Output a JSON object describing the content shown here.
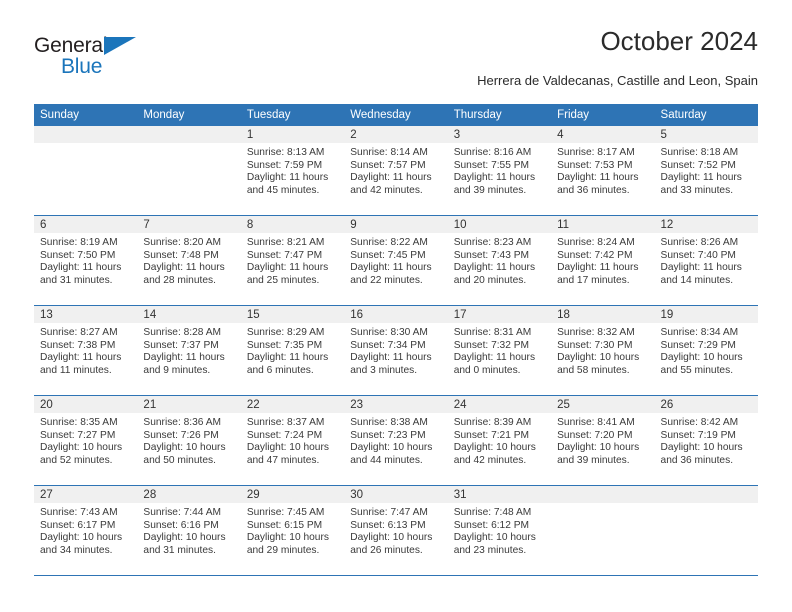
{
  "brand": {
    "name_top": "General",
    "name_bottom": "Blue",
    "triangle_color": "#1b75bb"
  },
  "header": {
    "title": "October 2024",
    "subtitle": "Herrera de Valdecanas, Castille and Leon, Spain"
  },
  "theme": {
    "header_blue": "#2e74b5",
    "daynum_band": "#f0f0f0",
    "text": "#3a3a3a"
  },
  "weekday_headers": [
    "Sunday",
    "Monday",
    "Tuesday",
    "Wednesday",
    "Thursday",
    "Friday",
    "Saturday"
  ],
  "weeks": [
    [
      {
        "day": "",
        "sunrise": "",
        "sunset": "",
        "daylight1": "",
        "daylight2": ""
      },
      {
        "day": "",
        "sunrise": "",
        "sunset": "",
        "daylight1": "",
        "daylight2": ""
      },
      {
        "day": "1",
        "sunrise": "Sunrise: 8:13 AM",
        "sunset": "Sunset: 7:59 PM",
        "daylight1": "Daylight: 11 hours",
        "daylight2": "and 45 minutes."
      },
      {
        "day": "2",
        "sunrise": "Sunrise: 8:14 AM",
        "sunset": "Sunset: 7:57 PM",
        "daylight1": "Daylight: 11 hours",
        "daylight2": "and 42 minutes."
      },
      {
        "day": "3",
        "sunrise": "Sunrise: 8:16 AM",
        "sunset": "Sunset: 7:55 PM",
        "daylight1": "Daylight: 11 hours",
        "daylight2": "and 39 minutes."
      },
      {
        "day": "4",
        "sunrise": "Sunrise: 8:17 AM",
        "sunset": "Sunset: 7:53 PM",
        "daylight1": "Daylight: 11 hours",
        "daylight2": "and 36 minutes."
      },
      {
        "day": "5",
        "sunrise": "Sunrise: 8:18 AM",
        "sunset": "Sunset: 7:52 PM",
        "daylight1": "Daylight: 11 hours",
        "daylight2": "and 33 minutes."
      }
    ],
    [
      {
        "day": "6",
        "sunrise": "Sunrise: 8:19 AM",
        "sunset": "Sunset: 7:50 PM",
        "daylight1": "Daylight: 11 hours",
        "daylight2": "and 31 minutes."
      },
      {
        "day": "7",
        "sunrise": "Sunrise: 8:20 AM",
        "sunset": "Sunset: 7:48 PM",
        "daylight1": "Daylight: 11 hours",
        "daylight2": "and 28 minutes."
      },
      {
        "day": "8",
        "sunrise": "Sunrise: 8:21 AM",
        "sunset": "Sunset: 7:47 PM",
        "daylight1": "Daylight: 11 hours",
        "daylight2": "and 25 minutes."
      },
      {
        "day": "9",
        "sunrise": "Sunrise: 8:22 AM",
        "sunset": "Sunset: 7:45 PM",
        "daylight1": "Daylight: 11 hours",
        "daylight2": "and 22 minutes."
      },
      {
        "day": "10",
        "sunrise": "Sunrise: 8:23 AM",
        "sunset": "Sunset: 7:43 PM",
        "daylight1": "Daylight: 11 hours",
        "daylight2": "and 20 minutes."
      },
      {
        "day": "11",
        "sunrise": "Sunrise: 8:24 AM",
        "sunset": "Sunset: 7:42 PM",
        "daylight1": "Daylight: 11 hours",
        "daylight2": "and 17 minutes."
      },
      {
        "day": "12",
        "sunrise": "Sunrise: 8:26 AM",
        "sunset": "Sunset: 7:40 PM",
        "daylight1": "Daylight: 11 hours",
        "daylight2": "and 14 minutes."
      }
    ],
    [
      {
        "day": "13",
        "sunrise": "Sunrise: 8:27 AM",
        "sunset": "Sunset: 7:38 PM",
        "daylight1": "Daylight: 11 hours",
        "daylight2": "and 11 minutes."
      },
      {
        "day": "14",
        "sunrise": "Sunrise: 8:28 AM",
        "sunset": "Sunset: 7:37 PM",
        "daylight1": "Daylight: 11 hours",
        "daylight2": "and 9 minutes."
      },
      {
        "day": "15",
        "sunrise": "Sunrise: 8:29 AM",
        "sunset": "Sunset: 7:35 PM",
        "daylight1": "Daylight: 11 hours",
        "daylight2": "and 6 minutes."
      },
      {
        "day": "16",
        "sunrise": "Sunrise: 8:30 AM",
        "sunset": "Sunset: 7:34 PM",
        "daylight1": "Daylight: 11 hours",
        "daylight2": "and 3 minutes."
      },
      {
        "day": "17",
        "sunrise": "Sunrise: 8:31 AM",
        "sunset": "Sunset: 7:32 PM",
        "daylight1": "Daylight: 11 hours",
        "daylight2": "and 0 minutes."
      },
      {
        "day": "18",
        "sunrise": "Sunrise: 8:32 AM",
        "sunset": "Sunset: 7:30 PM",
        "daylight1": "Daylight: 10 hours",
        "daylight2": "and 58 minutes."
      },
      {
        "day": "19",
        "sunrise": "Sunrise: 8:34 AM",
        "sunset": "Sunset: 7:29 PM",
        "daylight1": "Daylight: 10 hours",
        "daylight2": "and 55 minutes."
      }
    ],
    [
      {
        "day": "20",
        "sunrise": "Sunrise: 8:35 AM",
        "sunset": "Sunset: 7:27 PM",
        "daylight1": "Daylight: 10 hours",
        "daylight2": "and 52 minutes."
      },
      {
        "day": "21",
        "sunrise": "Sunrise: 8:36 AM",
        "sunset": "Sunset: 7:26 PM",
        "daylight1": "Daylight: 10 hours",
        "daylight2": "and 50 minutes."
      },
      {
        "day": "22",
        "sunrise": "Sunrise: 8:37 AM",
        "sunset": "Sunset: 7:24 PM",
        "daylight1": "Daylight: 10 hours",
        "daylight2": "and 47 minutes."
      },
      {
        "day": "23",
        "sunrise": "Sunrise: 8:38 AM",
        "sunset": "Sunset: 7:23 PM",
        "daylight1": "Daylight: 10 hours",
        "daylight2": "and 44 minutes."
      },
      {
        "day": "24",
        "sunrise": "Sunrise: 8:39 AM",
        "sunset": "Sunset: 7:21 PM",
        "daylight1": "Daylight: 10 hours",
        "daylight2": "and 42 minutes."
      },
      {
        "day": "25",
        "sunrise": "Sunrise: 8:41 AM",
        "sunset": "Sunset: 7:20 PM",
        "daylight1": "Daylight: 10 hours",
        "daylight2": "and 39 minutes."
      },
      {
        "day": "26",
        "sunrise": "Sunrise: 8:42 AM",
        "sunset": "Sunset: 7:19 PM",
        "daylight1": "Daylight: 10 hours",
        "daylight2": "and 36 minutes."
      }
    ],
    [
      {
        "day": "27",
        "sunrise": "Sunrise: 7:43 AM",
        "sunset": "Sunset: 6:17 PM",
        "daylight1": "Daylight: 10 hours",
        "daylight2": "and 34 minutes."
      },
      {
        "day": "28",
        "sunrise": "Sunrise: 7:44 AM",
        "sunset": "Sunset: 6:16 PM",
        "daylight1": "Daylight: 10 hours",
        "daylight2": "and 31 minutes."
      },
      {
        "day": "29",
        "sunrise": "Sunrise: 7:45 AM",
        "sunset": "Sunset: 6:15 PM",
        "daylight1": "Daylight: 10 hours",
        "daylight2": "and 29 minutes."
      },
      {
        "day": "30",
        "sunrise": "Sunrise: 7:47 AM",
        "sunset": "Sunset: 6:13 PM",
        "daylight1": "Daylight: 10 hours",
        "daylight2": "and 26 minutes."
      },
      {
        "day": "31",
        "sunrise": "Sunrise: 7:48 AM",
        "sunset": "Sunset: 6:12 PM",
        "daylight1": "Daylight: 10 hours",
        "daylight2": "and 23 minutes."
      },
      {
        "day": "",
        "sunrise": "",
        "sunset": "",
        "daylight1": "",
        "daylight2": ""
      },
      {
        "day": "",
        "sunrise": "",
        "sunset": "",
        "daylight1": "",
        "daylight2": ""
      }
    ]
  ]
}
